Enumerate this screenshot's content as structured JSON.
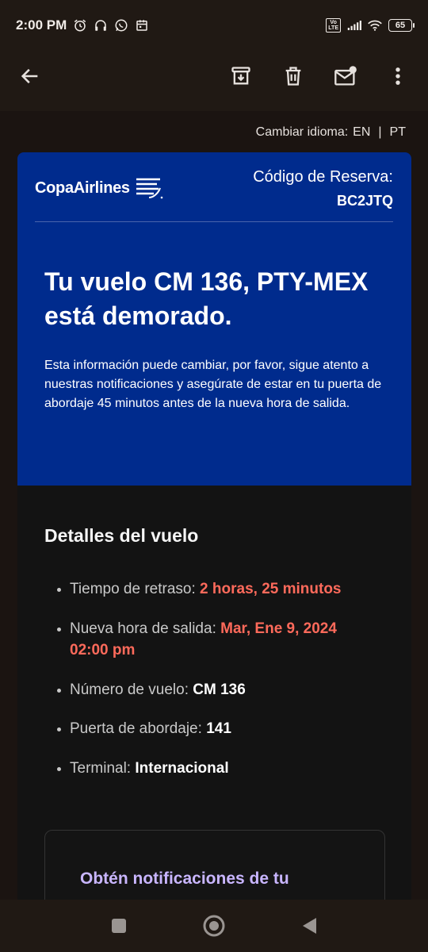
{
  "status_bar": {
    "time": "2:00 PM",
    "volte_label": "Vo\nLTE",
    "battery": "65",
    "icons": [
      "alarm-icon",
      "headphones-icon",
      "whatsapp-icon",
      "calendar-icon",
      "signal-icon",
      "wifi-icon"
    ]
  },
  "app_bar": {
    "icons": [
      "back-arrow-icon",
      "archive-icon",
      "delete-icon",
      "mark-unread-icon",
      "more-vert-icon"
    ]
  },
  "language": {
    "label": "Cambiar idioma:",
    "options": [
      "EN",
      "PT"
    ],
    "separator": "|"
  },
  "header": {
    "brand": "CopaAirlines",
    "reserva_label": "Código de Reserva:",
    "reserva_code": "BC2JTQ",
    "headline": "Tu vuelo CM 136, PTY-MEX está demorado.",
    "info": "Esta información puede cambiar, por favor, sigue atento a nuestras notificaciones y asegúrate de estar en tu puerta de abordaje 45 minutos antes de la nueva hora de salida."
  },
  "details": {
    "title": "Detalles del vuelo",
    "items": [
      {
        "label": "Tiempo de retraso: ",
        "value": "2 horas, 25 minutos",
        "style": "red"
      },
      {
        "label": "Nueva hora de salida: ",
        "value": "Mar, Ene 9, 2024 02:00 pm",
        "style": "red"
      },
      {
        "label": "Número de vuelo: ",
        "value": "CM 136",
        "style": "white"
      },
      {
        "label": "Puerta de abordaje: ",
        "value": "141",
        "style": "white"
      },
      {
        "label": "Terminal: ",
        "value": "Internacional",
        "style": "white"
      }
    ]
  },
  "notify": {
    "title": "Obtén notificaciones de tu"
  },
  "nav_bar": {
    "icons": [
      "recents-square-icon",
      "home-circle-icon",
      "back-triangle-icon"
    ]
  },
  "colors": {
    "copa_blue": "#002b8d",
    "delay_red": "#ff6a5b",
    "accent_purple": "#c9b6ff"
  }
}
